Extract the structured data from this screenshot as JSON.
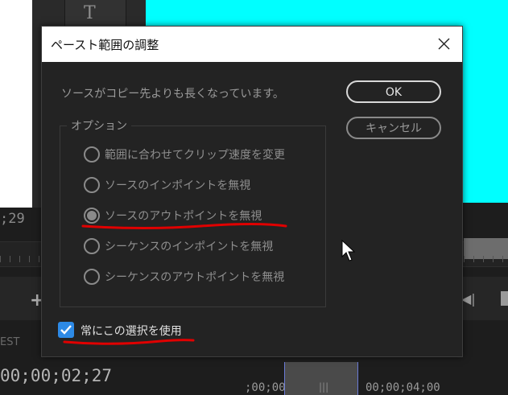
{
  "background": {
    "tool_glyph": "T",
    "timecode_left": ";29",
    "label_est": "EST",
    "timecode_current": "00;00;02;27",
    "timeline_left": ";00;00",
    "timeline_right": "00;00;04;00"
  },
  "dialog": {
    "title": "ペースト範囲の調整",
    "message": "ソースがコピー先よりも長くなっています。",
    "ok_label": "OK",
    "cancel_label": "キャンセル",
    "options_legend": "オプション",
    "options": [
      {
        "label": "範囲に合わせてクリップ速度を変更",
        "selected": false
      },
      {
        "label": "ソースのインポイントを無視",
        "selected": false
      },
      {
        "label": "ソースのアウトポイントを無視",
        "selected": true
      },
      {
        "label": "シーケンスのインポイントを無視",
        "selected": false
      },
      {
        "label": "シーケンスのアウトポイントを無視",
        "selected": false
      }
    ],
    "always_use_label": "常にこの選択を使用",
    "always_use_checked": true
  },
  "colors": {
    "dialog_bg": "#232323",
    "checkbox_accent": "#2d8ae6",
    "annotation_red": "#e00000",
    "canvas_cyan": "#00ffff"
  },
  "icons": [
    "text-tool-icon",
    "close-icon",
    "checkmark-icon",
    "mouse-pointer-icon",
    "add-icon",
    "step-back-icon"
  ]
}
